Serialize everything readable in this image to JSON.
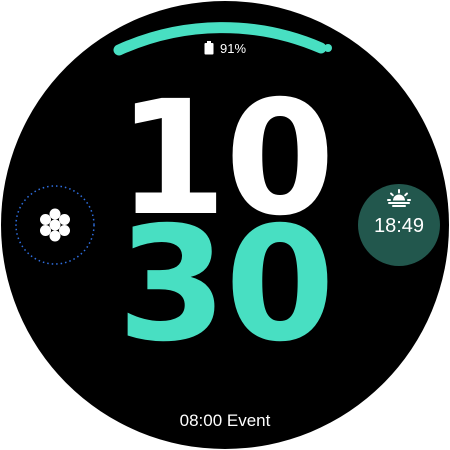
{
  "battery": {
    "percent_label": "91%",
    "level": 0.91,
    "icon": "battery-icon",
    "arc_color": "#48dfc2"
  },
  "time": {
    "hour": "10",
    "minute": "30",
    "hour_color": "#ffffff",
    "minute_color": "#48dfc2"
  },
  "left_complication": {
    "icon": "apps-icon",
    "ring_color": "#2f6fe0"
  },
  "right_complication": {
    "icon": "sunrise-icon",
    "time": "18:49",
    "background": "#22574d"
  },
  "event": {
    "label": "08:00 Event"
  }
}
